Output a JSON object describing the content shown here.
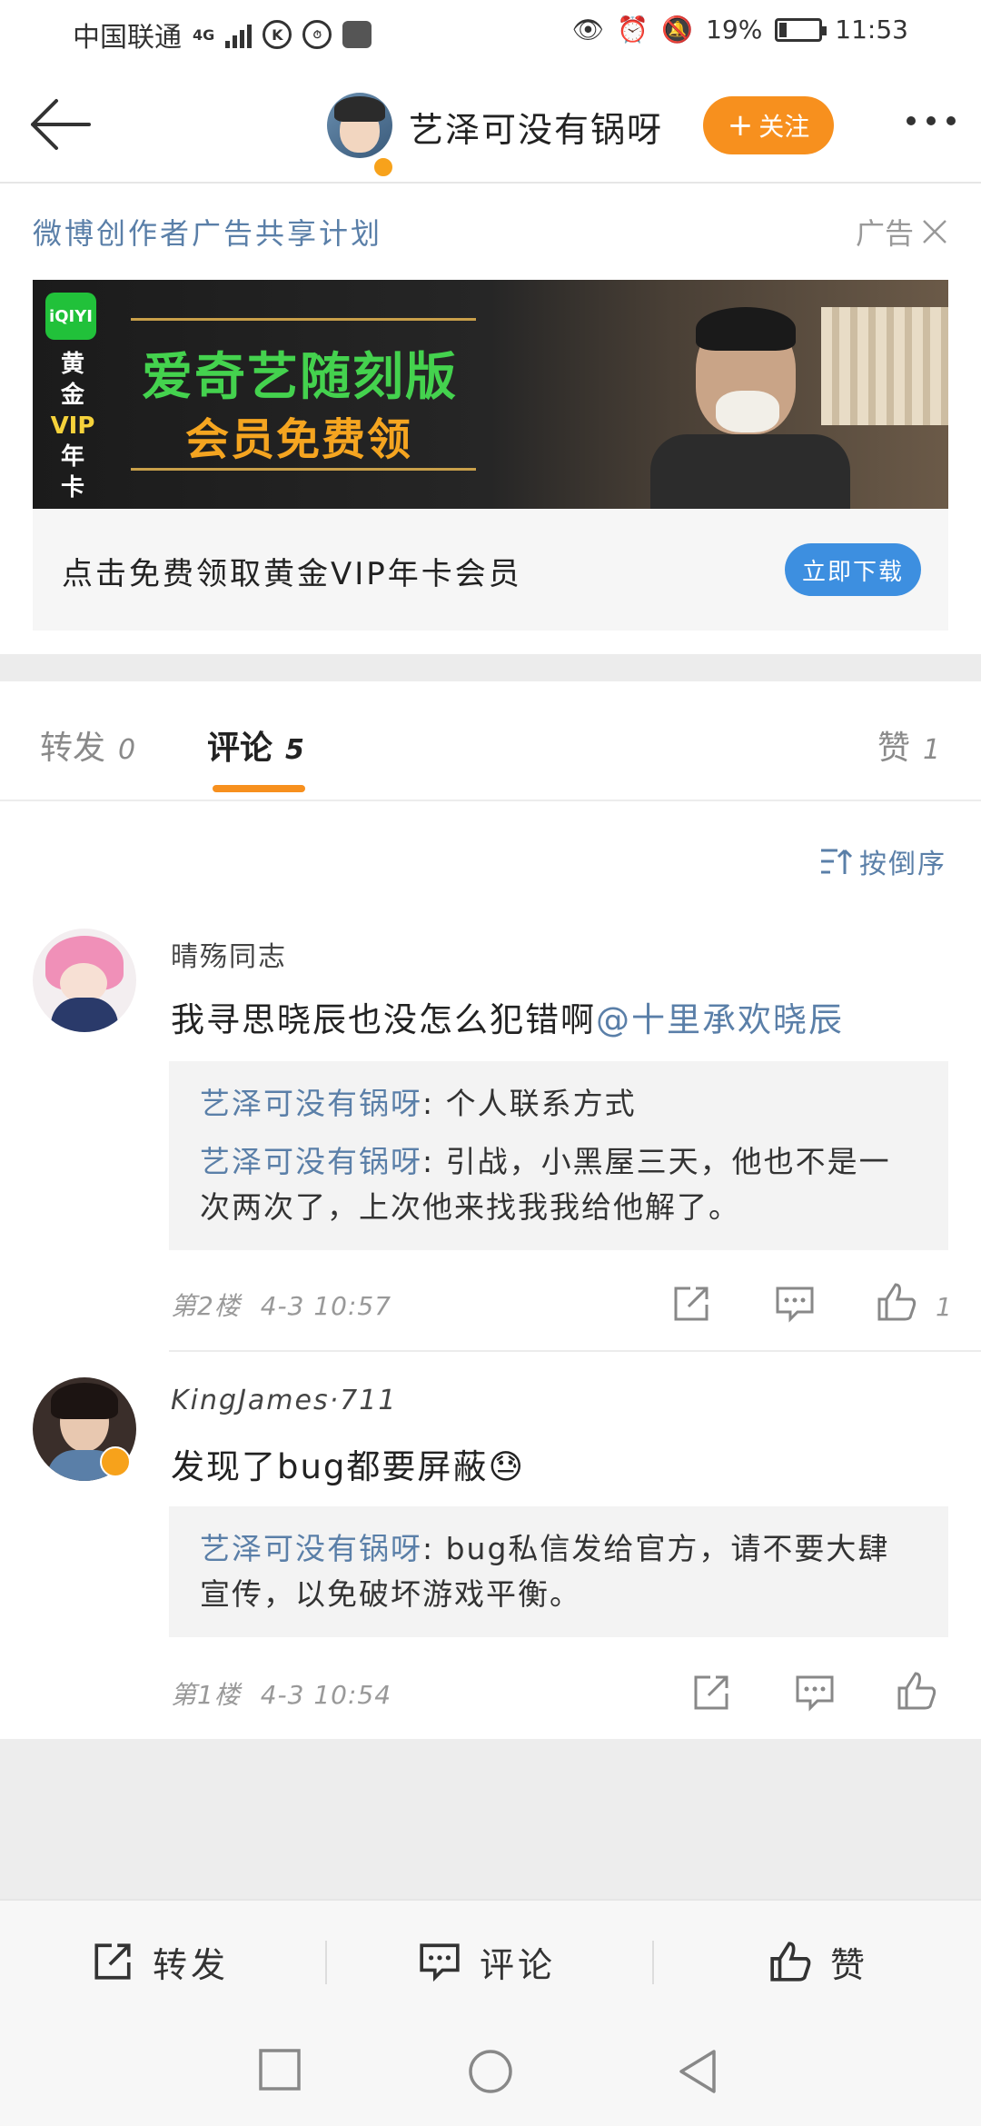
{
  "status_bar": {
    "carrier": "中国联通",
    "network": "4G",
    "battery": "19%",
    "battery_level": 0.19,
    "time": "11:53"
  },
  "nav": {
    "title": "艺泽可没有锅呀",
    "follow_label": "关注"
  },
  "ad": {
    "plan_text": "微博创作者广告共享计划",
    "ad_label": "广告",
    "banner": {
      "logo": "iQIYI",
      "vip_lines": [
        "黄",
        "金",
        "VIP",
        "年",
        "卡"
      ],
      "headline1": "爱奇艺随刻版",
      "headline2": "会员免费领"
    },
    "description": "点击免费领取黄金VIP年卡会员",
    "download_label": "立即下载"
  },
  "tabs": {
    "repost_label": "转发",
    "repost_count": "0",
    "comment_label": "评论",
    "comment_count": "5",
    "like_label": "赞",
    "like_count": "1"
  },
  "sort_label": "按倒序",
  "comments": [
    {
      "name": "晴殇同志",
      "text": "我寻思晓辰也没怎么犯错啊",
      "mention": "@十里承欢晓辰",
      "replies": [
        {
          "who": "艺泽可没有锅呀",
          "text": ": 个人联系方式"
        },
        {
          "who": "艺泽可没有锅呀",
          "text": ": 引战，小黑屋三天，他也不是一次两次了，上次他来找我我给他解了。"
        }
      ],
      "floor": "第2楼",
      "time": "4-3 10:57",
      "likes": "1"
    },
    {
      "name": "KingJames·711",
      "text": "发现了bug都要屏蔽",
      "emoji": "😓",
      "replies": [
        {
          "who": "艺泽可没有锅呀",
          "text": ": bug私信发给官方，请不要大肆宣传，以免破坏游戏平衡。"
        }
      ],
      "floor": "第1楼",
      "time": "4-3 10:54",
      "likes": ""
    }
  ],
  "bottom_bar": {
    "repost": "转发",
    "comment": "评论",
    "like": "赞"
  },
  "colors": {
    "accent_orange": "#f7901e",
    "link_blue": "#5a7fa8",
    "download_blue": "#3d8fe0"
  }
}
